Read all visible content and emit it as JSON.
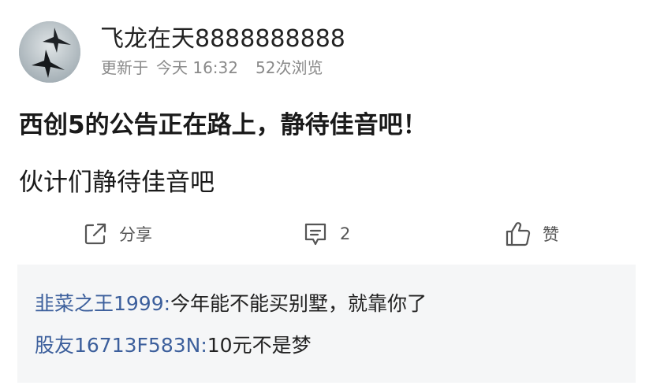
{
  "post": {
    "author": "飞龙在天8888888888",
    "updated_label": "更新于",
    "updated_time": "今天 16:32",
    "views": "52次浏览",
    "title": "西创5的公告正在路上，静待佳音吧！",
    "body": "伙计们静待佳音吧"
  },
  "actions": {
    "share_label": "分享",
    "share_icon": "share-icon",
    "comment_count": "2",
    "comment_icon": "comment-icon",
    "like_label": "赞",
    "like_icon": "thumbs-up-icon"
  },
  "comments": [
    {
      "author": "韭菜之王1999:",
      "text": "今年能不能买别墅，就靠你了"
    },
    {
      "author": "股友16713F583N:",
      "text": "10元不是梦"
    }
  ],
  "colors": {
    "comment_author": "#3c5f9c",
    "comment_bg": "#f5f6f7",
    "meta_text": "#8a8a8a"
  }
}
